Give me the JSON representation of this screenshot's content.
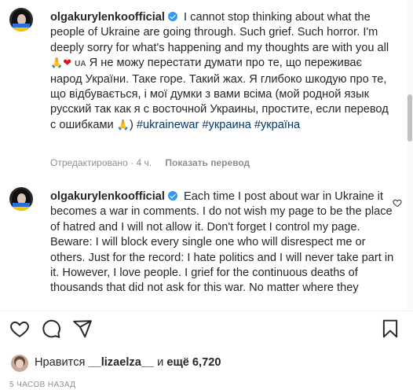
{
  "comments": [
    {
      "username": "olgakurylenkoofficial",
      "text_en": "I cannot stop thinking about what the people of Ukraine are going through. Such grief. Such horror. I'm deeply sorry for what's happening and my thoughts are with you all",
      "ua_tag": "UA",
      "text_ua": "Я не можу перестати думати про те, що переживає народ України. Таке горе. Такий жах. Я глибоко шкодую про те, що відбувається, і мої думки з вами всіма (мой родной язык русский так как я с восточной Украины, простите, если перевод с ошибками",
      "text_close": ")",
      "hashtags": [
        "#ukrainewar",
        "#украина",
        "#україна"
      ],
      "edited_label": "Отредактировано",
      "time": "4 ч.",
      "translate_label": "Показать перевод"
    },
    {
      "username": "olgakurylenkoofficial",
      "text": "Each time I post about war in Ukraine it becomes a war in comments. I do not wish my page to be the place of hatred and I will not allow it. Don't forget I control my page. Beware: I will block every single one who will disrespect me or others. Just for the record: I hate politics and I will never take part in it. However, I love people. I grief for the continuous deaths of thousands that did not ask for this war. No matter where they"
    }
  ],
  "likes": {
    "prefix": "Нравится",
    "user": "__lizaelza__",
    "middle": "и",
    "count": "ещё 6,720"
  },
  "timestamp": "5 ЧАСОВ НАЗАД",
  "icons": {
    "like": "heart-outline-icon",
    "comment": "speech-bubble-icon",
    "share": "paper-plane-icon",
    "save": "bookmark-icon",
    "verified": "verified-badge-icon"
  },
  "colors": {
    "text": "#262626",
    "hashtag": "#00376b",
    "muted": "#8e8e8e",
    "verified": "#3897f0",
    "heart": "#d6151c"
  }
}
